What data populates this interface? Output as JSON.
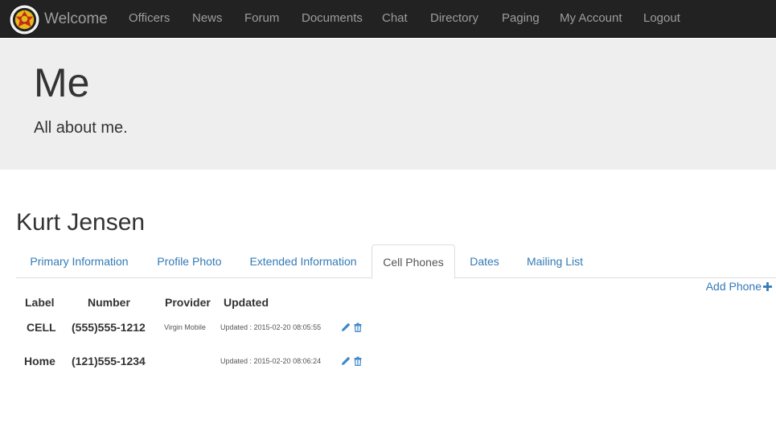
{
  "nav": {
    "brand": "Welcome",
    "items": [
      "Officers",
      "News",
      "Forum",
      "Documents",
      "Chat",
      "Directory",
      "Paging",
      "My Account",
      "Logout"
    ]
  },
  "jumbotron": {
    "title": "Me",
    "subtitle": "All about me."
  },
  "user": {
    "name": "Kurt Jensen"
  },
  "tabs": [
    {
      "label": "Primary Information",
      "active": false
    },
    {
      "label": "Profile Photo",
      "active": false
    },
    {
      "label": "Extended Information",
      "active": false
    },
    {
      "label": "Cell Phones",
      "active": true
    },
    {
      "label": "Dates",
      "active": false
    },
    {
      "label": "Mailing List",
      "active": false
    }
  ],
  "actions": {
    "add_phone": "Add Phone"
  },
  "table": {
    "headers": {
      "label": "Label",
      "number": "Number",
      "provider": "Provider",
      "updated": "Updated"
    },
    "rows": [
      {
        "label": "CELL",
        "number": "(555)555-1212",
        "provider": "Virgin Mobile",
        "updated": "Updated : 2015-02-20 08:05:55"
      },
      {
        "label": "Home",
        "number": "(121)555-1234",
        "provider": "",
        "updated": "Updated : 2015-02-20 08:06:24"
      }
    ]
  },
  "colors": {
    "navbar": "#222222",
    "link": "#337ab7",
    "jumbotron": "#eeeeee",
    "icon_blue": "#3a87c8"
  }
}
